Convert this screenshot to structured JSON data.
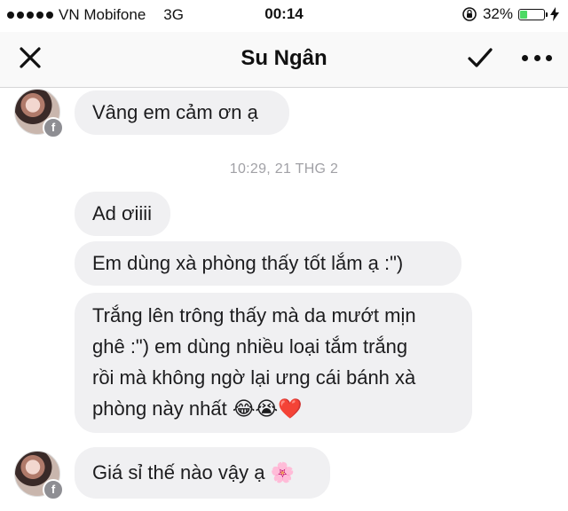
{
  "status_bar": {
    "carrier": "VN Mobifone",
    "network": "3G",
    "time": "00:14",
    "battery_percent": "32%",
    "battery_level": 0.32,
    "battery_color": "#4cd964"
  },
  "nav": {
    "title": "Su Ngân",
    "close_icon": "close-icon",
    "confirm_icon": "checkmark-icon",
    "more_icon": "more-dots-icon"
  },
  "messages": [
    {
      "text": "Vâng em cảm ơn ạ"
    },
    {
      "text": "Ad ơiiii"
    },
    {
      "text": "Em dùng xà phòng thấy tốt lắm ạ :\")"
    },
    {
      "lines": [
        "Trắng lên trông thấy mà da mướt mịn",
        "ghê :\") em dùng nhiều loại tắm trắng",
        "rồi mà không ngờ lại ưng cái bánh xà",
        "phòng này nhất"
      ],
      "emoji": "😂😭❤️"
    },
    {
      "text": "Giá sỉ thế nào vậy ạ",
      "emoji": "🌸"
    }
  ],
  "timestamp": "10:29, 21 THG 2",
  "colors": {
    "bubble_bg": "#f0f0f2",
    "timestamp": "#a1a1a6"
  }
}
